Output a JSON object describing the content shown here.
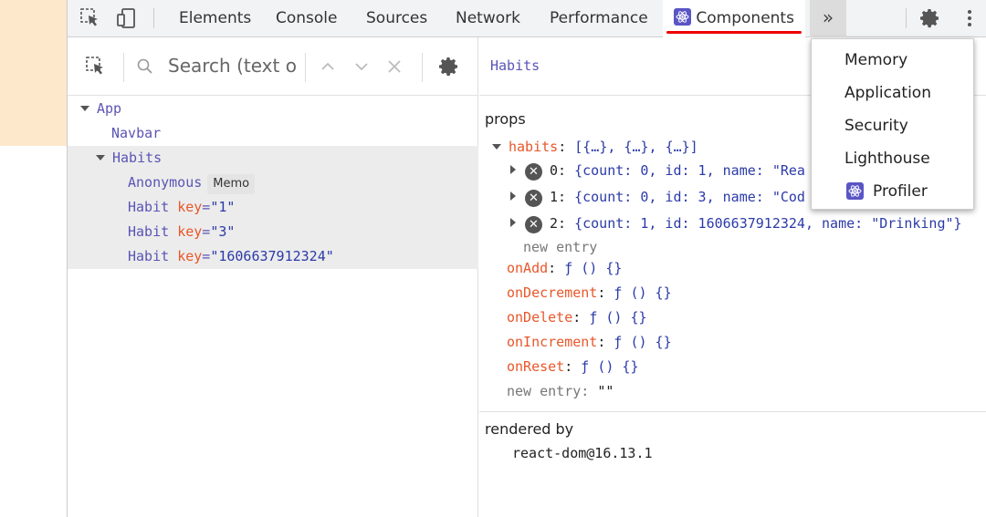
{
  "tabs": {
    "elements": "Elements",
    "console": "Console",
    "sources": "Sources",
    "network": "Network",
    "performance": "Performance",
    "components": "Components",
    "more": "»"
  },
  "icons": {
    "inspect": "cursor-select-icon",
    "device": "device-toolbar-icon",
    "settings": "gear-icon",
    "kebab": "vertical-dots-icon",
    "search": "search-icon",
    "up": "chevron-up-icon",
    "down": "chevron-down-icon",
    "clear": "close-icon",
    "react": "react-logo-icon"
  },
  "colors": {
    "accent_underline": "#e00000",
    "component_name": "#5a55b5",
    "prop_name": "#e8572a",
    "prop_value": "#2b3aa8",
    "react_badge": "#5a55c5"
  },
  "search": {
    "placeholder": "Search (text or"
  },
  "tree": {
    "app": "App",
    "navbar": "Navbar",
    "habits": "Habits",
    "anonymous": "Anonymous",
    "memo_badge": "Memo",
    "habit_rows": [
      {
        "name": "Habit",
        "key_label": "key",
        "eq": "=",
        "key_value": "\"1\""
      },
      {
        "name": "Habit",
        "key_label": "key",
        "eq": "=",
        "key_value": "\"3\""
      },
      {
        "name": "Habit",
        "key_label": "key",
        "eq": "=",
        "key_value": "\"1606637912324\""
      }
    ]
  },
  "inspector": {
    "component_name": "Habits",
    "props_title": "props",
    "habits_label": "habits",
    "colon": ":",
    "habits_value": "[{…}, {…}, {…}]",
    "habit_items": [
      {
        "index": "0:",
        "value": "{count: 0, id: 1, name: \"Rea"
      },
      {
        "index": "1:",
        "value": "{count: 0, id: 3, name: \"Cod"
      },
      {
        "index": "2:",
        "value": "{count: 1, id: 1606637912324, name: \"Drinking\"}"
      }
    ],
    "new_entry_inner": "new entry",
    "functions": [
      {
        "name": "onAdd",
        "value": "ƒ () {}"
      },
      {
        "name": "onDecrement",
        "value": "ƒ () {}"
      },
      {
        "name": "onDelete",
        "value": "ƒ () {}"
      },
      {
        "name": "onIncrement",
        "value": "ƒ () {}"
      },
      {
        "name": "onReset",
        "value": "ƒ () {}"
      }
    ],
    "new_entry_label": "new entry",
    "new_entry_value": "\"\"",
    "rendered_by_title": "rendered by",
    "rendered_by_value": "react-dom@16.13.1"
  },
  "menu": {
    "items": [
      "Memory",
      "Application",
      "Security",
      "Lighthouse",
      "Profiler"
    ]
  }
}
